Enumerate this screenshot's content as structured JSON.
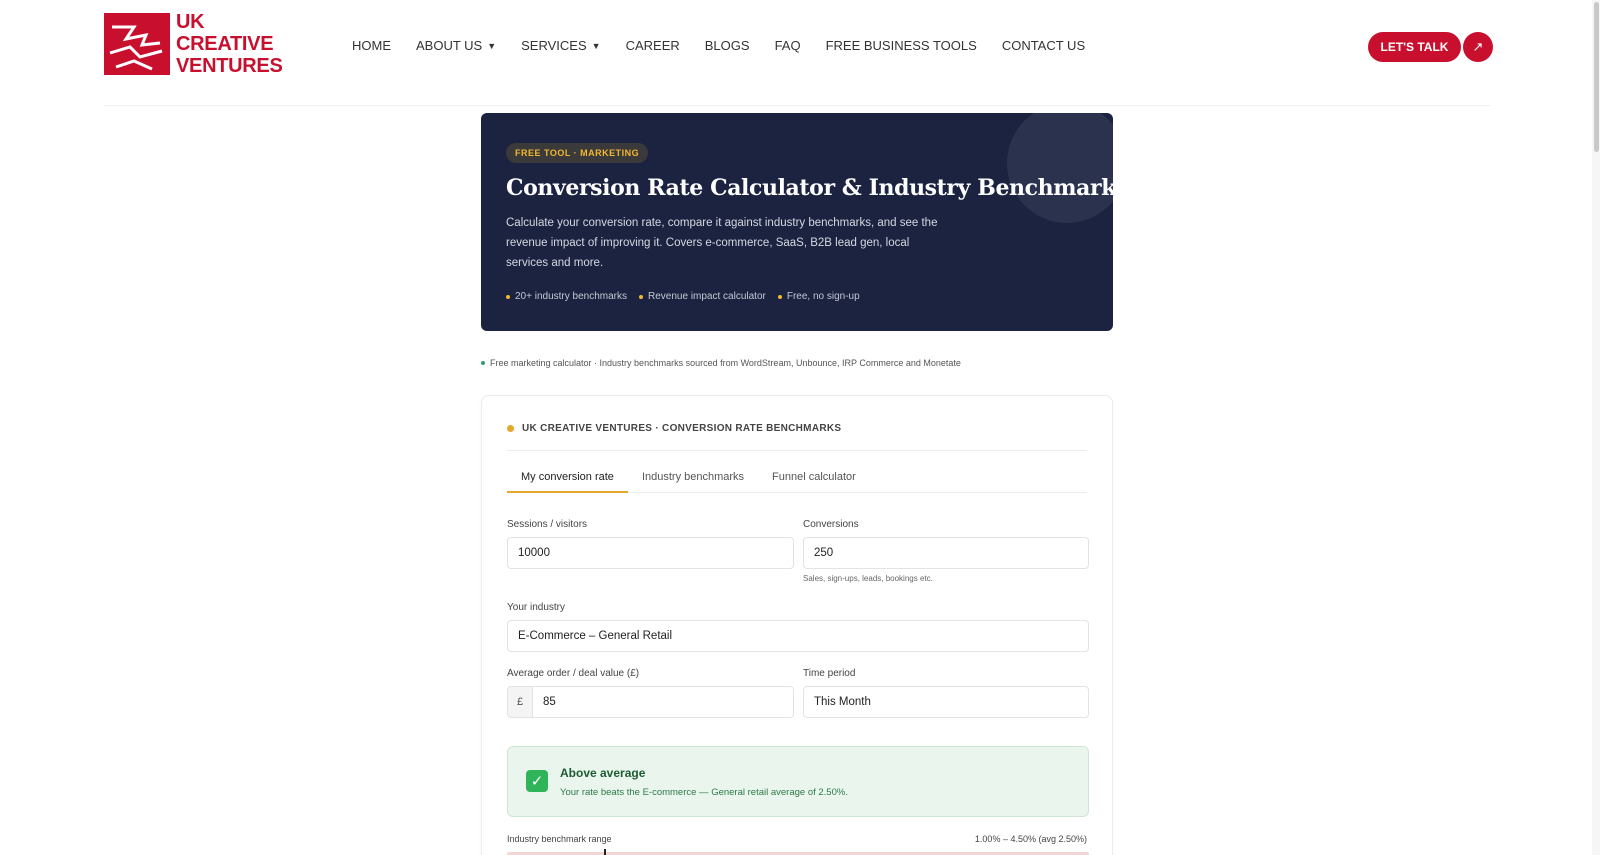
{
  "brand": {
    "name_line1": "UK",
    "name_line2": "CREATIVE",
    "name_line3": "VENTURES",
    "color": "#c8102e"
  },
  "nav": {
    "items": [
      {
        "label": "HOME",
        "dropdown": false
      },
      {
        "label": "ABOUT US",
        "dropdown": true
      },
      {
        "label": "SERVICES",
        "dropdown": true
      },
      {
        "label": "CAREER",
        "dropdown": false
      },
      {
        "label": "BLOGS",
        "dropdown": false
      },
      {
        "label": "FAQ",
        "dropdown": false
      },
      {
        "label": "FREE BUSINESS TOOLS",
        "dropdown": false
      },
      {
        "label": "CONTACT US",
        "dropdown": false
      }
    ],
    "cta_label": "LET'S TALK",
    "cta_icon": "arrow-up-right-icon"
  },
  "hero": {
    "badge": "FREE TOOL · MARKETING",
    "title": "Conversion Rate Calculator & Industry Benchmarks",
    "description": "Calculate your conversion rate, compare it against industry benchmarks, and see the revenue impact of improving it. Covers e-commerce, SaaS, B2B lead gen, local services and more.",
    "features": [
      "20+ industry benchmarks",
      "Revenue impact calculator",
      "Free, no sign-up"
    ],
    "background": "#1b2340",
    "accent": "#f2b632"
  },
  "note": "Free marketing calculator · Industry benchmarks sourced from WordStream, Unbounce, IRP Commerce and Monetate",
  "calculator": {
    "header": "UK CREATIVE VENTURES · CONVERSION RATE BENCHMARKS",
    "tabs": [
      "My conversion rate",
      "Industry benchmarks",
      "Funnel calculator"
    ],
    "active_tab": "My conversion rate",
    "sessions": {
      "label": "Sessions / visitors",
      "value": "10000"
    },
    "conversions": {
      "label": "Conversions",
      "value": "250",
      "hint": "Sales, sign-ups, leads, bookings etc."
    },
    "industry": {
      "label": "Your industry",
      "value": "E-Commerce – General Retail"
    },
    "order_value": {
      "label": "Average order / deal value (£)",
      "currency": "£",
      "value": "85"
    },
    "period": {
      "label": "Time period",
      "value": "This Month"
    },
    "result": {
      "title": "Above average",
      "text": "Your rate beats the E-commerce — General retail average of 2.50%.",
      "icon": "check-icon",
      "color": "#2fb45a"
    },
    "benchmark": {
      "label": "Industry benchmark range",
      "range_text": "1.00% – 4.50% (avg 2.50%)",
      "min": 1.0,
      "max": 4.5,
      "avg": 2.5
    }
  }
}
